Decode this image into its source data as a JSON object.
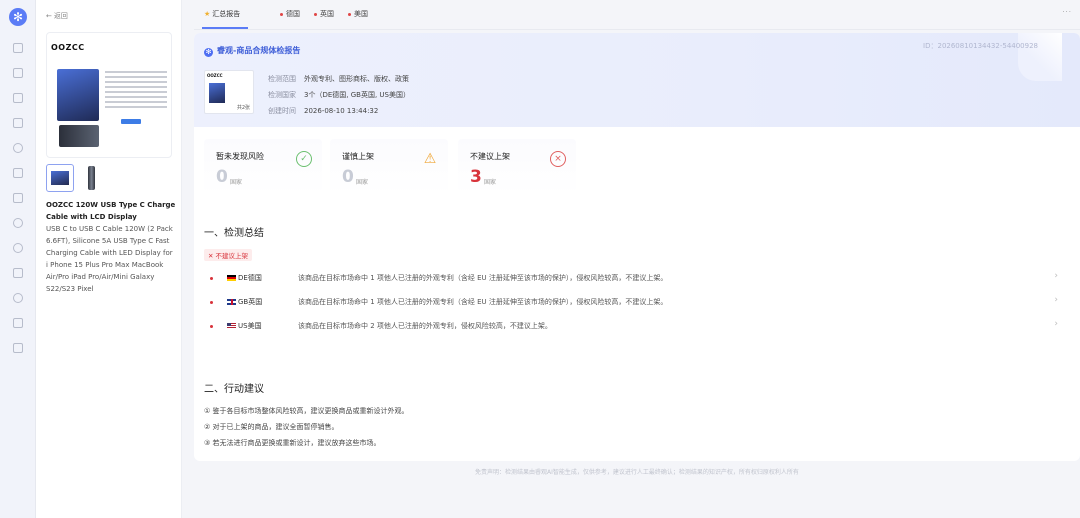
{
  "sidebar": {
    "icons": [
      "app-logo-icon",
      "document-icon",
      "printer-icon",
      "grid-icon",
      "file-icon",
      "tag-icon",
      "copy-icon",
      "shield-icon",
      "check-icon",
      "globe-icon",
      "chart-icon",
      "search-image-icon",
      "scan-icon",
      "layers-icon"
    ]
  },
  "product": {
    "back_label": "返回",
    "brand_text": "OOZCC",
    "title": "OOZCC 120W USB Type C Charge Cable with LCD Display",
    "description": "USB C to USB C Cable 120W (2 Pack 6.6FT), Silicone 5A USB Type C Fast Charging Cable with LED Display for i Phone 15 Plus Pro Max MacBook Air/Pro iPad Pro/Air/Mini Galaxy S22/S23 Pixel"
  },
  "tabs": [
    {
      "label": "汇总报告",
      "active": true
    },
    {
      "label": "德国"
    },
    {
      "label": "英国"
    },
    {
      "label": "美国"
    }
  ],
  "more_label": "···",
  "report": {
    "title": "睿观-商品合规体检报告",
    "id_text": "ID：20260810134432-54400928",
    "thumb_count": "共2张",
    "info": [
      {
        "key": "检测范围",
        "value": "外观专利、图形商标、版权、政策"
      },
      {
        "key": "检测国家",
        "value": "3个（DE德国, GB英国, US美国）"
      },
      {
        "key": "创建时间",
        "value": "2026-08-10 13:44:32"
      }
    ]
  },
  "status_cards": [
    {
      "label": "暂未发现风险",
      "count": "0",
      "unit": "国家",
      "icon": "check-circle-icon"
    },
    {
      "label": "谨慎上架",
      "count": "0",
      "unit": "国家",
      "icon": "warning-triangle-icon"
    },
    {
      "label": "不建议上架",
      "count": "3",
      "unit": "国家",
      "icon": "x-circle-icon"
    }
  ],
  "summary": {
    "heading": "一、检测总结",
    "badge": "不建议上架",
    "rows": [
      {
        "code": "DE德国",
        "flag": "de",
        "text": "该商品在目标市场命中 1 项他人已注册的外观专利（含经 EU 注册延伸至该市场的保护），侵权风险较高，不建议上架。"
      },
      {
        "code": "GB英国",
        "flag": "gb",
        "text": "该商品在目标市场命中 1 项他人已注册的外观专利（含经 EU 注册延伸至该市场的保护），侵权风险较高，不建议上架。"
      },
      {
        "code": "US美国",
        "flag": "us",
        "text": "该商品在目标市场命中 2 项他人已注册的外观专利，侵权风险较高，不建议上架。"
      }
    ]
  },
  "actions": {
    "heading": "二、行动建议",
    "items": [
      "① 鉴于各目标市场整体风险较高，建议更换商品或重新设计外观。",
      "② 对于已上架的商品，建议全面暂停销售。",
      "③ 若无法进行商品更换或重新设计，建议放弃这些市场。"
    ]
  },
  "footer": "免责声明：检测结果由睿观AI智能生成，仅供参考，建议进行人工最终确认；检测结果的知识产权，所有权归原权利人所有",
  "colors": {
    "accent": "#5b7cf6",
    "danger": "#d8333b",
    "ok": "#6cc070",
    "warn": "#f0a83a"
  }
}
